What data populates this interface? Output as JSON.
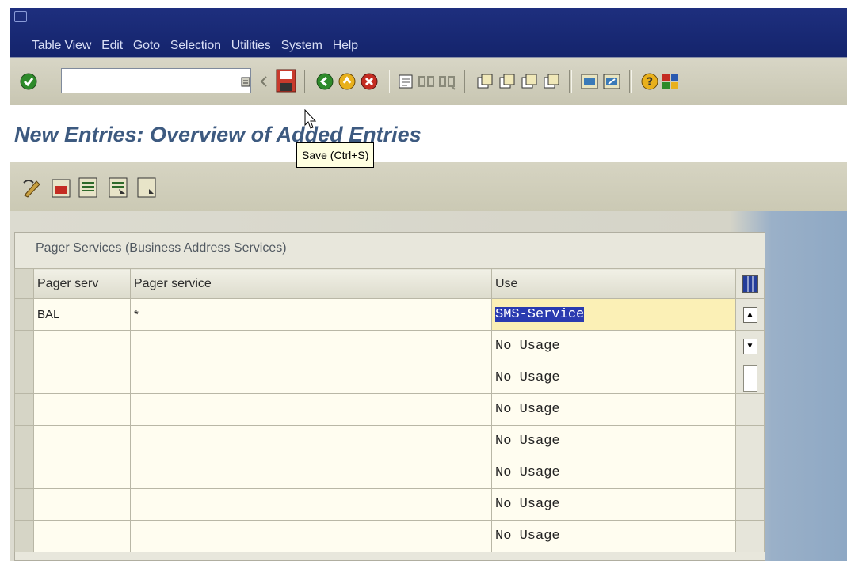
{
  "menubar": {
    "items": [
      "Table View",
      "Edit",
      "Goto",
      "Selection",
      "Utilities",
      "System",
      "Help"
    ]
  },
  "toolbar": {
    "command_field": {
      "value": "",
      "placeholder": ""
    },
    "icons": [
      "enter-icon",
      "command-dropdown-icon",
      "back-arrow-icon",
      "save-icon",
      "back-icon",
      "exit-icon",
      "cancel-icon",
      "print-icon",
      "find-icon",
      "find-next-icon",
      "first-page-icon",
      "previous-page-icon",
      "next-page-icon",
      "last-page-icon",
      "create-session-icon",
      "shortcut-icon",
      "help-icon",
      "layout-menu-icon"
    ]
  },
  "tooltip": {
    "text": "Save  (Ctrl+S)"
  },
  "page": {
    "title": "New Entries: Overview of Added Entries"
  },
  "app_toolbar": {
    "icons": [
      "change-display-icon",
      "delete-icon",
      "select-all-icon",
      "select-block-icon",
      "deselect-all-icon"
    ]
  },
  "frame": {
    "title": "Pager Services (Business Address Services)"
  },
  "table": {
    "columns": [
      "Pager serv",
      "Pager service",
      "Use"
    ],
    "rows": [
      {
        "pager_serv": "BAL",
        "pager_service": "*",
        "use": "SMS-Service"
      },
      {
        "pager_serv": "",
        "pager_service": "",
        "use": "No Usage"
      },
      {
        "pager_serv": "",
        "pager_service": "",
        "use": "No Usage"
      },
      {
        "pager_serv": "",
        "pager_service": "",
        "use": "No Usage"
      },
      {
        "pager_serv": "",
        "pager_service": "",
        "use": "No Usage"
      },
      {
        "pager_serv": "",
        "pager_service": "",
        "use": "No Usage"
      },
      {
        "pager_serv": "",
        "pager_service": "",
        "use": "No Usage"
      },
      {
        "pager_serv": "",
        "pager_service": "",
        "use": "No Usage"
      }
    ]
  },
  "colors": {
    "title_bar": "#1e2f7e",
    "page_title": "#3d5a80",
    "selection_highlight": "#2a3bb0",
    "row_background": "#fffdf0",
    "tooltip_background": "#ffffe1"
  }
}
